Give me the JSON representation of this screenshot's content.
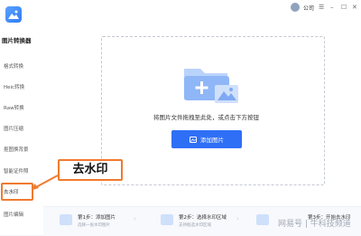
{
  "app": {
    "title": "图片转换器"
  },
  "sidebar": {
    "items": [
      {
        "label": "格式转换"
      },
      {
        "label": "Heic转换"
      },
      {
        "label": "Raw转换"
      },
      {
        "label": "图片压缩"
      },
      {
        "label": "抠图换背景"
      },
      {
        "label": "智能证件照"
      },
      {
        "label": "去水印"
      },
      {
        "label": "图片编辑"
      }
    ],
    "active_index": 6
  },
  "topbar": {
    "account_label": "公司"
  },
  "main": {
    "drop_hint": "将图片文件拖拽至此处，或点击下方按钮",
    "add_button_label": "添加图片"
  },
  "callout": {
    "label": "去水印"
  },
  "steps": [
    {
      "title": "第1步：添加图片",
      "desc": "选择一张水印图片"
    },
    {
      "title": "第2步：选择水印区域",
      "desc": "支持框选水印区域"
    },
    {
      "title": "第3步：开始去水印",
      "desc": ""
    }
  ],
  "watermark": {
    "text": "网易号 | 牛科技频道"
  },
  "colors": {
    "accent": "#2f6ff6",
    "callout": "#f07a2f"
  },
  "icons": {
    "window_controls": [
      "menu-icon",
      "minimize-icon",
      "maximize-icon",
      "close-icon"
    ]
  }
}
